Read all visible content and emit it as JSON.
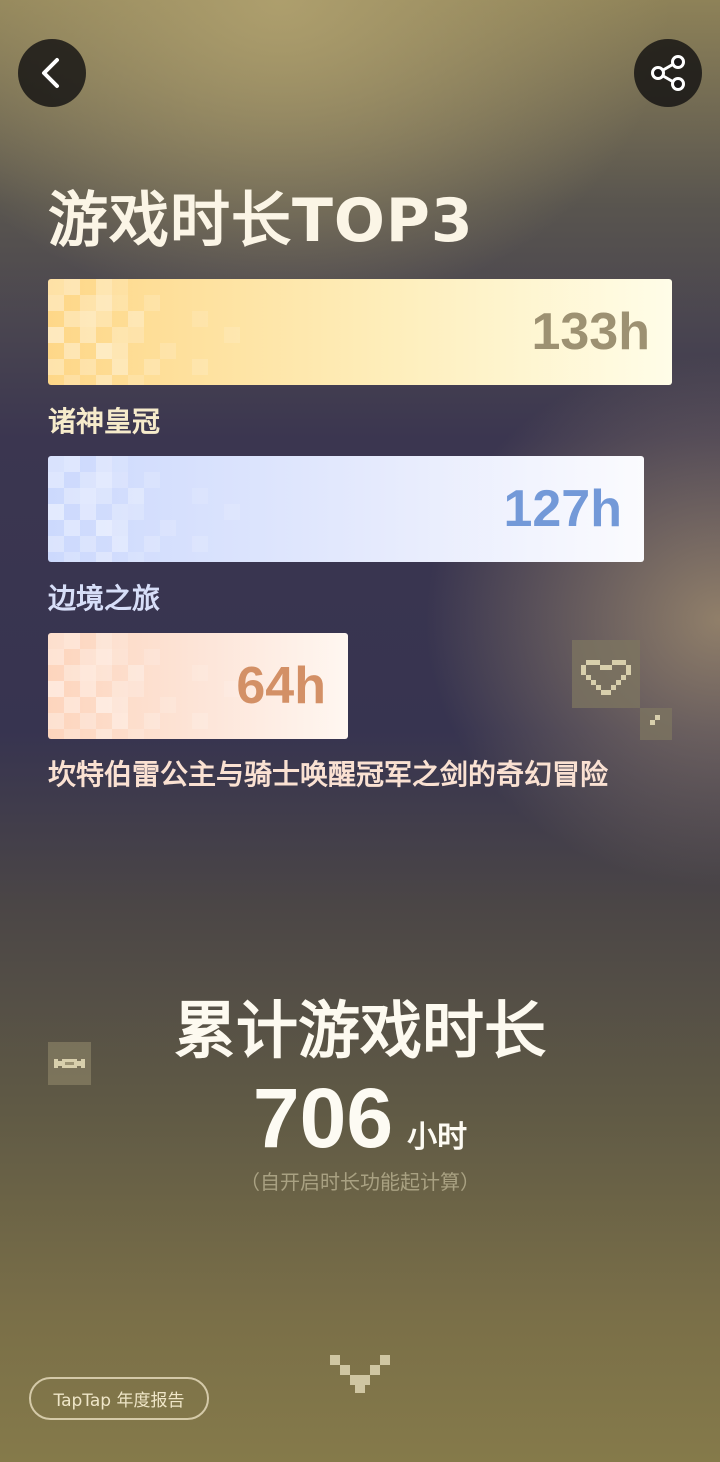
{
  "header": {
    "back_icon": "chevron-left-icon",
    "share_icon": "share-icon"
  },
  "title": "游戏时长TOP3",
  "games": [
    {
      "name": "诸神皇冠",
      "hours_label": "133h",
      "hours": 133,
      "color": "#fed788"
    },
    {
      "name": "边境之旅",
      "hours_label": "127h",
      "hours": 127,
      "color": "#ccd9fd"
    },
    {
      "name": "坎特伯雷公主与骑士唤醒冠军之剑的奇幻冒险",
      "hours_label": "64h",
      "hours": 64,
      "color": "#fdd5bd"
    }
  ],
  "total": {
    "title": "累计游戏时长",
    "value": "706",
    "unit": "小时",
    "note": "（自开启时长功能起计算）"
  },
  "footer": {
    "brand": "TapTap 年度报告",
    "scroll_icon": "pixel-chevron-down-icon"
  },
  "decorations": [
    "pixel-heart-icon",
    "pixel-candy-icon"
  ]
}
